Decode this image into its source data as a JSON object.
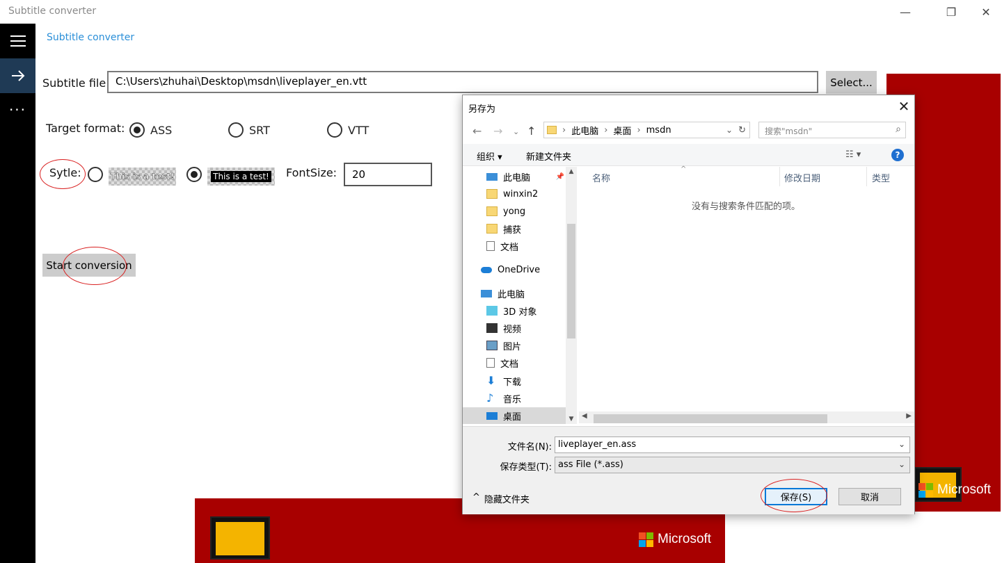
{
  "window": {
    "title": "Subtitle converter",
    "controls": {
      "minimize": "—",
      "maximize": "❐",
      "close": "✕"
    }
  },
  "nav": {
    "more": "···"
  },
  "page": {
    "header": "Subtitle converter",
    "subtitle_file_label": "Subtitle file:",
    "subtitle_file_value": "C:\\Users\\zhuhai\\Desktop\\msdn\\liveplayer_en.vtt",
    "select_button": "Select...",
    "target_format_label": "Target format:",
    "formats": [
      {
        "label": "ASS",
        "checked": true
      },
      {
        "label": "SRT",
        "checked": false
      },
      {
        "label": "VTT",
        "checked": false
      }
    ],
    "style_label": "Sytle:",
    "style_preview_1": "This is a test!",
    "style_preview_2": "This is a test!",
    "fontsize_label": "FontSize:",
    "fontsize_value": "20",
    "start_button": "Start conversion"
  },
  "ads": {
    "brand": "Microsoft"
  },
  "colors": {
    "accent": "#2b8fd8",
    "ad_red": "#a80000",
    "annotation": "#d92020",
    "nav_bg": "#000000"
  },
  "dialog": {
    "title": "另存为",
    "breadcrumb": [
      "此电脑",
      "桌面",
      "msdn"
    ],
    "search_placeholder": "搜索\"msdn\"",
    "toolbar": {
      "organize": "组织 ▾",
      "new_folder": "新建文件夹"
    },
    "nav_items": [
      {
        "label": "此电脑",
        "icon": "pc-icon"
      },
      {
        "label": "winxin2",
        "icon": "folder-icon"
      },
      {
        "label": "yong",
        "icon": "folder-icon"
      },
      {
        "label": "捕获",
        "icon": "folder-icon"
      },
      {
        "label": "文档",
        "icon": "document-icon"
      },
      {
        "label": "OneDrive",
        "icon": "cloud-icon"
      },
      {
        "label": "此电脑",
        "icon": "pc-icon"
      },
      {
        "label": "3D 对象",
        "icon": "cube-icon"
      },
      {
        "label": "视频",
        "icon": "video-icon"
      },
      {
        "label": "图片",
        "icon": "picture-icon"
      },
      {
        "label": "文档",
        "icon": "document-icon"
      },
      {
        "label": "下载",
        "icon": "download-icon"
      },
      {
        "label": "音乐",
        "icon": "music-icon"
      },
      {
        "label": "桌面",
        "icon": "desktop-icon"
      }
    ],
    "columns": {
      "name": "名称",
      "date": "修改日期",
      "type": "类型"
    },
    "empty_message": "没有与搜索条件匹配的项。",
    "filename_label": "文件名(N):",
    "filename_value": "liveplayer_en.ass",
    "filetype_label": "保存类型(T):",
    "filetype_value": "ass File (*.ass)",
    "hide_folders": "隐藏文件夹",
    "save_button": "保存(S)",
    "cancel_button": "取消"
  }
}
